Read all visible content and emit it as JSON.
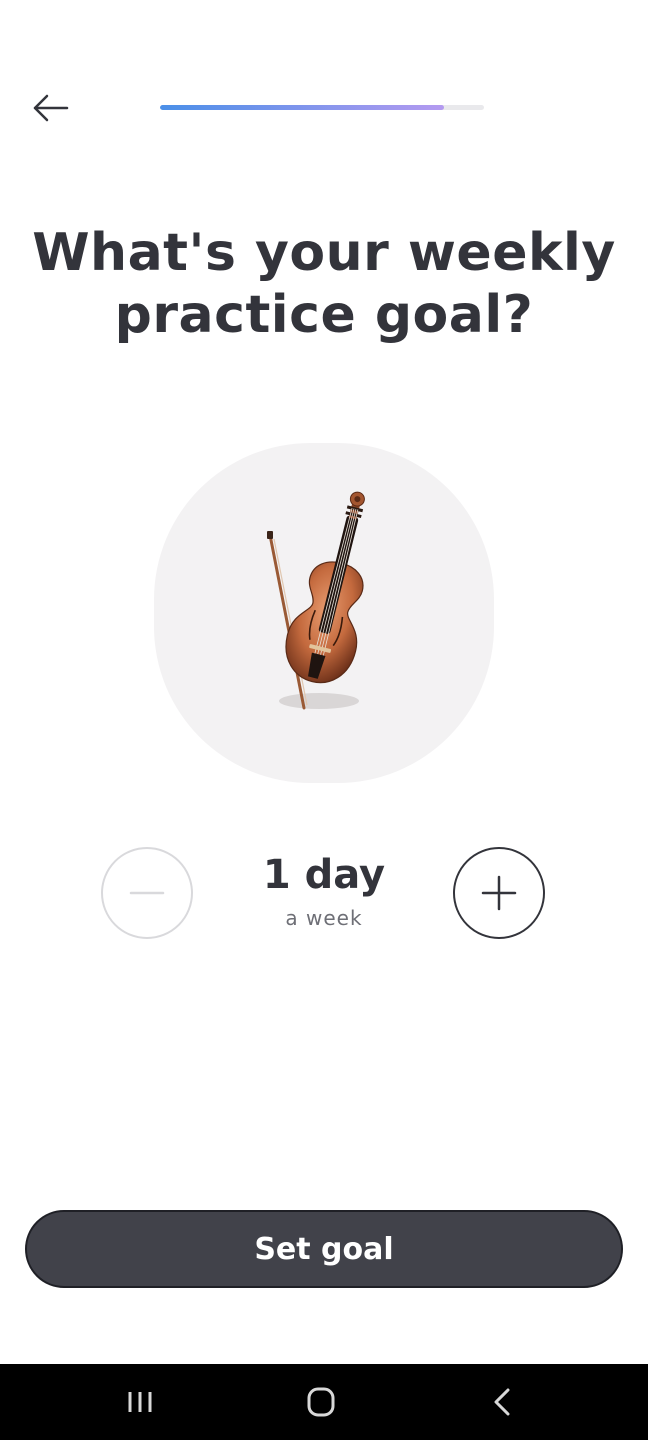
{
  "header": {
    "back_icon": "arrow-left-icon",
    "progress": 0.875,
    "progress_colors": [
      "#4a8fe8",
      "#b49af0"
    ]
  },
  "question": {
    "title_line1": "What's your weekly",
    "title_line2": "practice goal?"
  },
  "illustration": {
    "icon": "violin-icon"
  },
  "stepper": {
    "value": "1 day",
    "unit": "a week",
    "minus_icon": "minus-icon",
    "plus_icon": "plus-icon",
    "minus_enabled": false
  },
  "cta": {
    "label": "Set goal"
  },
  "system_nav": {
    "recents_icon": "recents-icon",
    "home_icon": "home-icon",
    "back_icon": "back-chevron-icon"
  }
}
